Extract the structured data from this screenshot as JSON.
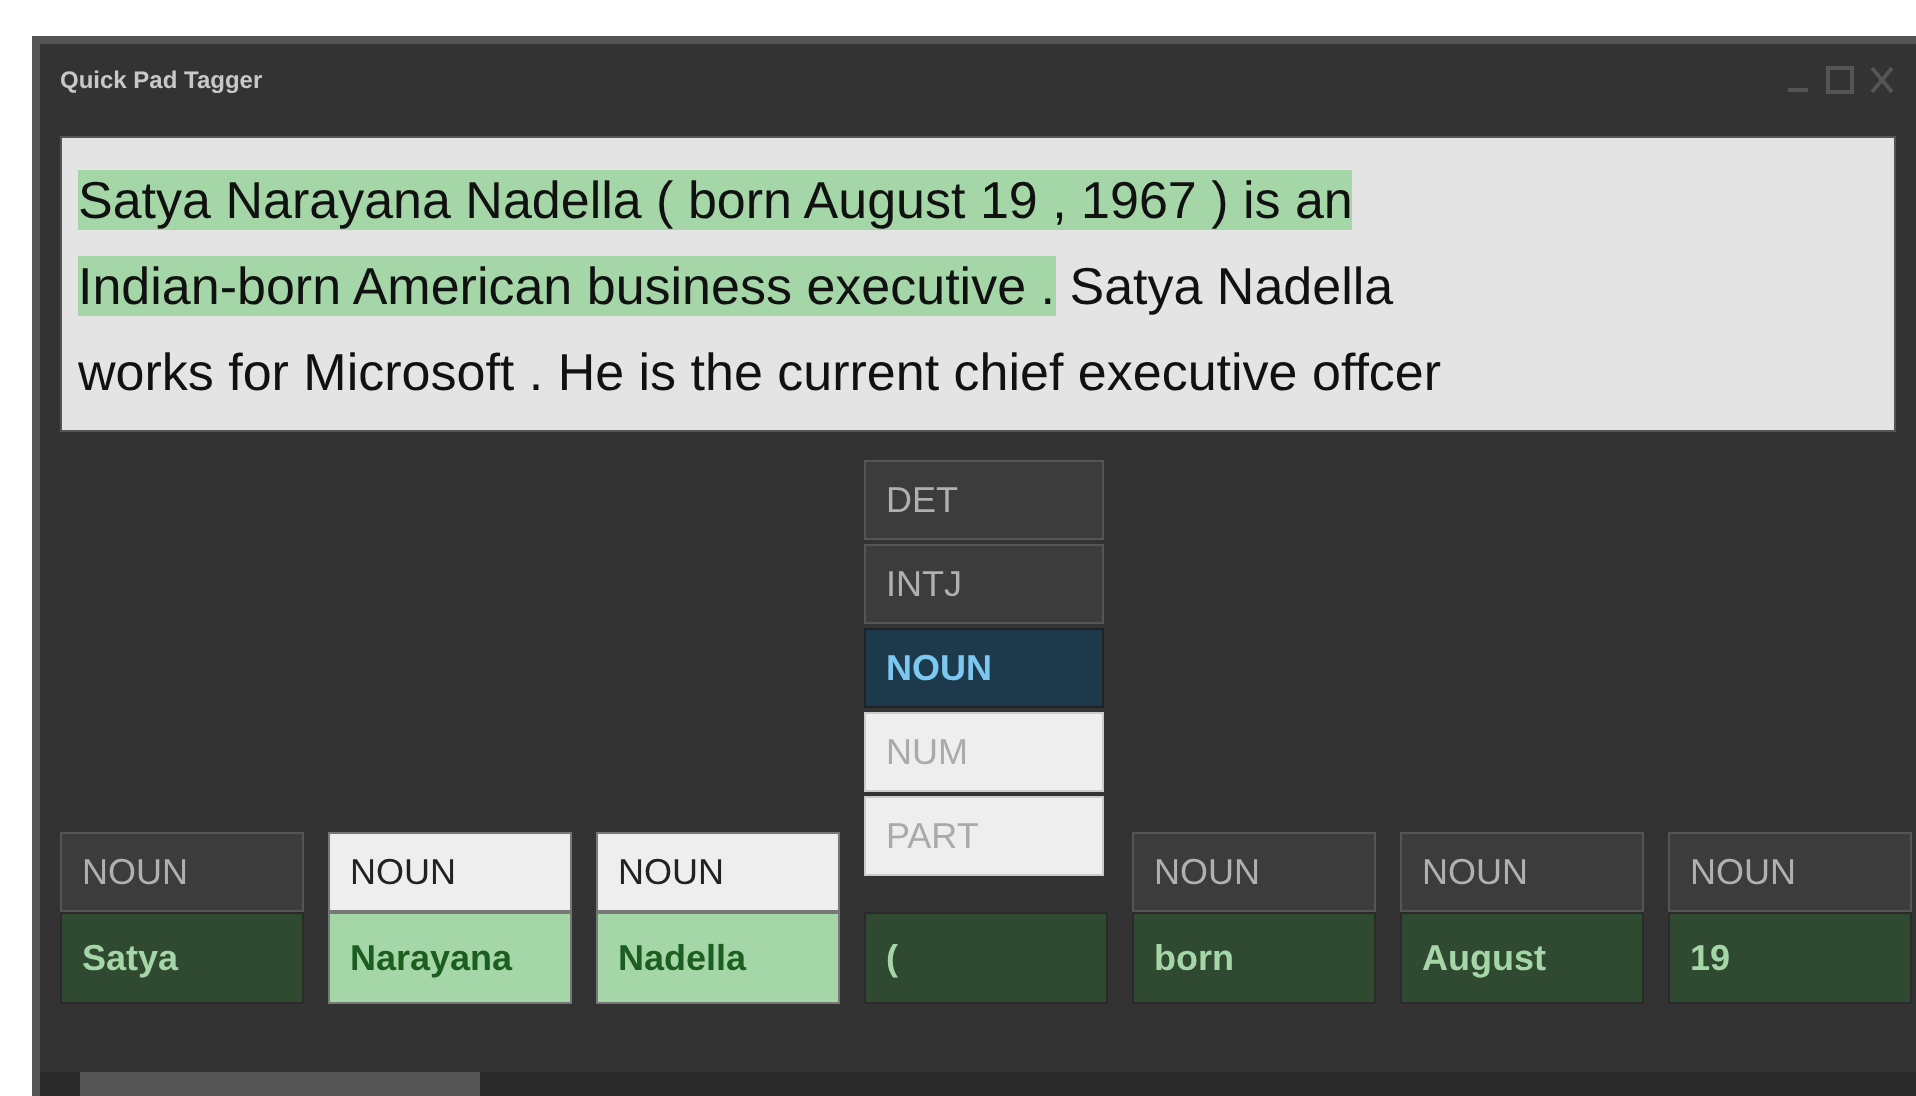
{
  "window": {
    "title": "Quick Pad Tagger"
  },
  "text_area": {
    "lines": [
      [
        {
          "text": "Satya Narayana Nadella ( born August 19 , 1967 ) is an",
          "tagged": true
        }
      ],
      [
        {
          "text": "Indian-born American business executive .",
          "tagged": true
        },
        {
          "text": " Satya Nadella",
          "tagged": false
        }
      ],
      [
        {
          "text": "works for Microsoft . He is the current chief executive offcer",
          "tagged": false
        }
      ]
    ]
  },
  "tag_menu": {
    "items": [
      {
        "label": "DET",
        "selected": false,
        "highlighted": false
      },
      {
        "label": "INTJ",
        "selected": false,
        "highlighted": false
      },
      {
        "label": "NOUN",
        "selected": true,
        "highlighted": false
      },
      {
        "label": "NUM",
        "selected": false,
        "highlighted": true
      },
      {
        "label": "PART",
        "selected": false,
        "highlighted": true
      }
    ]
  },
  "tokens": [
    {
      "tag": "NOUN",
      "word": "Satya",
      "highlighted": false
    },
    {
      "tag": "NOUN",
      "word": "Narayana",
      "highlighted": true
    },
    {
      "tag": "NOUN",
      "word": "Nadella",
      "highlighted": true
    },
    {
      "word": "(",
      "highlighted": false
    },
    {
      "tag": "NOUN",
      "word": "born",
      "highlighted": false
    },
    {
      "tag": "NOUN",
      "word": "August",
      "highlighted": false
    },
    {
      "tag": "NOUN",
      "word": "19",
      "highlighted": false
    }
  ]
}
